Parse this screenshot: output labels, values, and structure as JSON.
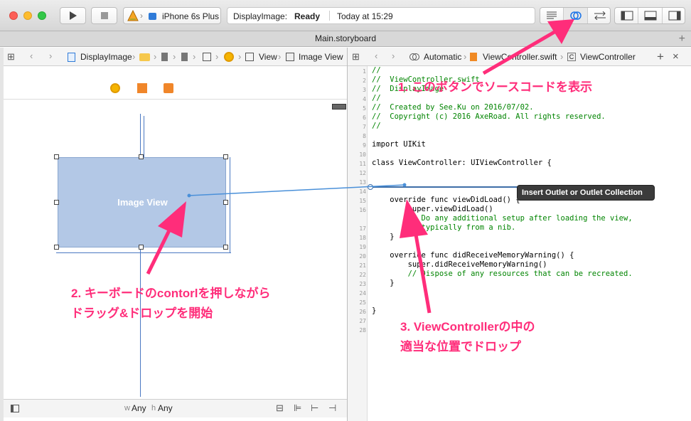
{
  "toolbar": {
    "scheme": "iPhone 6s Plus",
    "status_app": "DisplayImage:",
    "status_state": "Ready",
    "status_time": "Today at 15:29"
  },
  "tab": {
    "title": "Main.storyboard"
  },
  "left_jump": {
    "items": [
      "DisplayImage",
      "View",
      "Image View"
    ]
  },
  "right_jump": {
    "items": [
      "Automatic",
      "ViewController.swift",
      "ViewController"
    ]
  },
  "canvas": {
    "image_view_label": "Image View",
    "size_w": "w",
    "size_w_val": "Any",
    "size_h": "h",
    "size_h_val": "Any"
  },
  "editor": {
    "line_numbers": [
      "1",
      "2",
      "3",
      "4",
      "5",
      "6",
      "7",
      "8",
      "9",
      "10",
      "11",
      "12",
      "13",
      "14",
      "15",
      "16",
      "17",
      "18",
      "19",
      "20",
      "21",
      "22",
      "23",
      "24",
      "25",
      "26",
      "27",
      "28"
    ],
    "lines": [
      {
        "n": "1",
        "t": "//",
        "c": "cm"
      },
      {
        "n": "2",
        "t": "//  ViewController.swift",
        "c": "cm"
      },
      {
        "n": "3",
        "t": "//  DisplayImage",
        "c": "cm"
      },
      {
        "n": "4",
        "t": "//",
        "c": "cm"
      },
      {
        "n": "5",
        "t": "//  Created by See.Ku on 2016/07/02.",
        "c": "cm"
      },
      {
        "n": "6",
        "t": "//  Copyright (c) 2016 AxeRoad. All rights reserved.",
        "c": "cm"
      },
      {
        "n": "7",
        "t": "//",
        "c": "cm"
      },
      {
        "n": "9",
        "t": "import UIKit",
        "c": ""
      },
      {
        "n": "11",
        "t": "class ViewController: UIViewController {",
        "c": ""
      },
      {
        "n": "15",
        "t": "    override func viewDidLoad() {",
        "c": ""
      },
      {
        "n": "16",
        "t": "        super.viewDidLoad()",
        "c": ""
      },
      {
        "n": "17a",
        "t": "        // Do any additional setup after loading the view,",
        "c": "cm"
      },
      {
        "n": "17b",
        "t": "           typically from a nib.",
        "c": "cm"
      },
      {
        "n": "18",
        "t": "    }",
        "c": ""
      },
      {
        "n": "20",
        "t": "    override func didReceiveMemoryWarning() {",
        "c": ""
      },
      {
        "n": "21",
        "t": "        super.didReceiveMemoryWarning()",
        "c": ""
      },
      {
        "n": "22",
        "t": "        // Dispose of any resources that can be recreated.",
        "c": "cm"
      },
      {
        "n": "23",
        "t": "    }",
        "c": ""
      },
      {
        "n": "26",
        "t": "}",
        "c": ""
      }
    ],
    "tooltip": "Insert Outlet or Outlet Collection"
  },
  "annotations": {
    "step1": "1. このボタンでソースコードを表示",
    "step2_line1": "2. キーボードのcontorlを押しながら",
    "step2_line2": "ドラッグ&ドロップを開始",
    "step3_line1": "3. ViewControllerの中の",
    "step3_line2": "適当な位置でドロップ"
  },
  "colors": {
    "accent": "#ff2d7a",
    "image_view": "#b3c8e6",
    "connection": "#4a90d9"
  }
}
